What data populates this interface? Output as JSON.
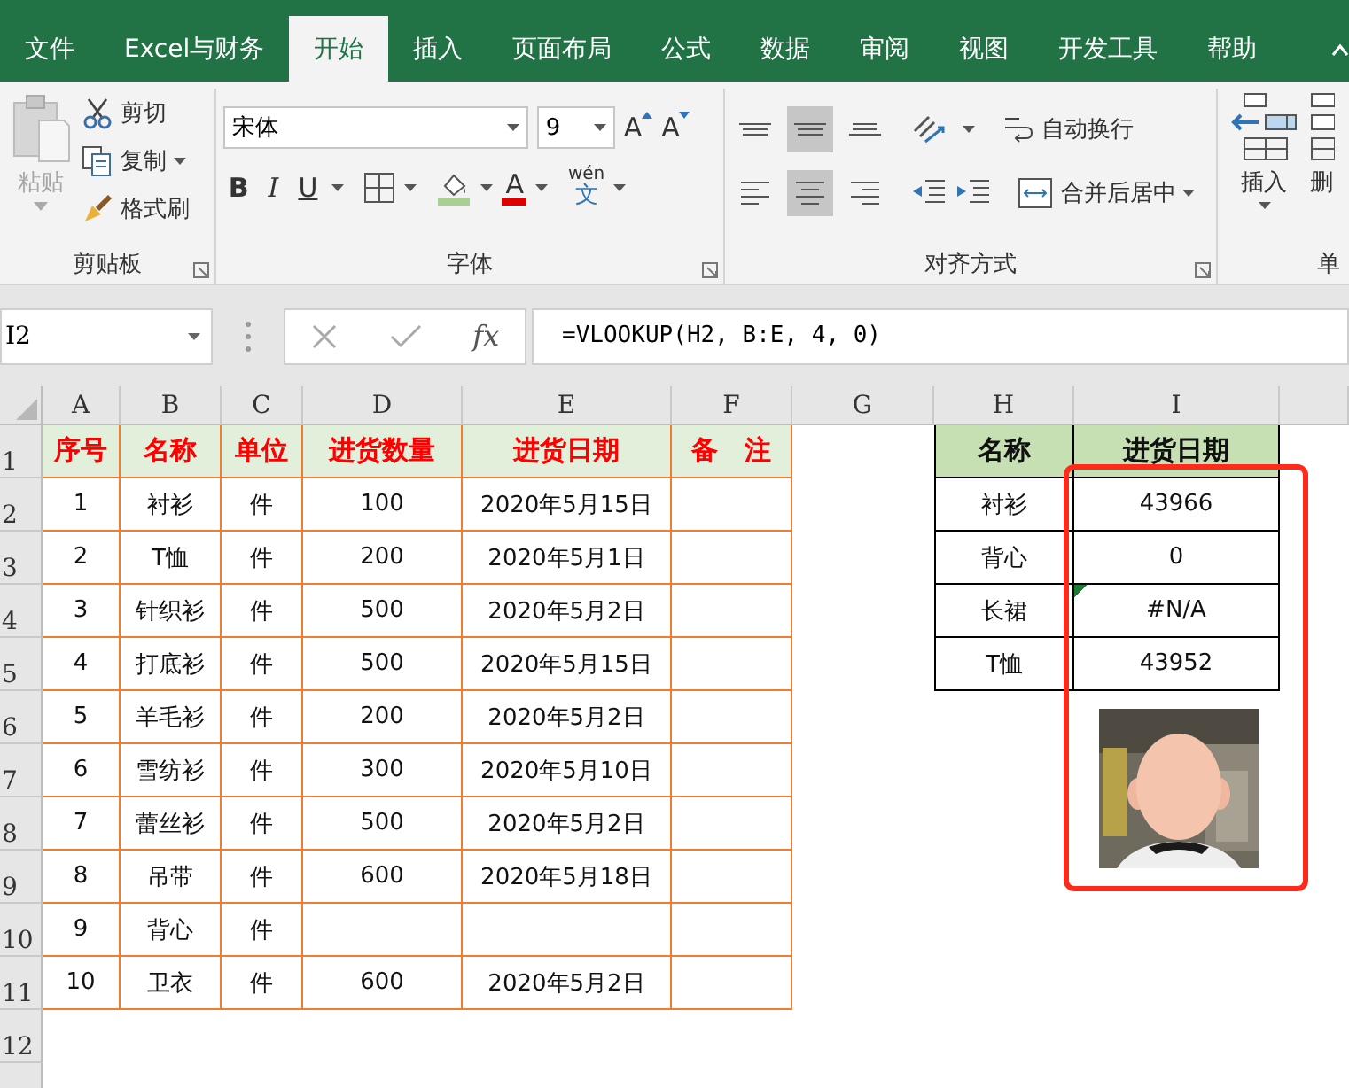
{
  "tabs": [
    {
      "label": "文件",
      "selected": false
    },
    {
      "label": "Excel与财务",
      "selected": false
    },
    {
      "label": "开始",
      "selected": true
    },
    {
      "label": "插入",
      "selected": false
    },
    {
      "label": "页面布局",
      "selected": false
    },
    {
      "label": "公式",
      "selected": false
    },
    {
      "label": "数据",
      "selected": false
    },
    {
      "label": "审阅",
      "selected": false
    },
    {
      "label": "视图",
      "selected": false
    },
    {
      "label": "开发工具",
      "selected": false
    },
    {
      "label": "帮助",
      "selected": false
    }
  ],
  "ribbon": {
    "clipboard": {
      "paste": "粘贴",
      "paste_disabled": true,
      "cut": "剪切",
      "copy": "复制",
      "format_painter": "格式刷",
      "label": "剪贴板"
    },
    "font": {
      "name": "宋体",
      "size": "9",
      "grow": "A",
      "shrink": "A",
      "bold": "B",
      "italic": "I",
      "underline": "U",
      "font_color": "A",
      "phonetic_top": "wén",
      "phonetic_bottom": "文",
      "label": "字体"
    },
    "alignment": {
      "vertical": [
        {
          "kind": "top",
          "selected": false
        },
        {
          "kind": "middle",
          "selected": true
        },
        {
          "kind": "bottom",
          "selected": false
        }
      ],
      "horizontal": [
        {
          "kind": "left",
          "selected": false
        },
        {
          "kind": "center",
          "selected": true
        },
        {
          "kind": "right",
          "selected": false
        }
      ],
      "wrap_text": "自动换行",
      "merge_center": "合并后居中",
      "label": "对齐方式"
    },
    "cells": {
      "insert": "插入",
      "delete": "删",
      "label": "单"
    }
  },
  "formula_bar": {
    "name_box": "I2",
    "fx": "fx",
    "formula": "=VLOOKUP(H2, B:E, 4, 0)"
  },
  "sheet": {
    "columns": [
      "A",
      "B",
      "C",
      "D",
      "E",
      "F",
      "G",
      "H",
      "I"
    ],
    "row_numbers": [
      "1",
      "2",
      "3",
      "4",
      "5",
      "6",
      "7",
      "8",
      "9",
      "10",
      "11",
      "12"
    ],
    "table": {
      "columns": [
        "序号",
        "名称",
        "单位",
        "进货数量",
        "进货日期",
        "备　注"
      ],
      "rows": [
        [
          "1",
          "衬衫",
          "件",
          "100",
          "2020年5月15日",
          ""
        ],
        [
          "2",
          "T恤",
          "件",
          "200",
          "2020年5月1日",
          ""
        ],
        [
          "3",
          "针织衫",
          "件",
          "500",
          "2020年5月2日",
          ""
        ],
        [
          "4",
          "打底衫",
          "件",
          "500",
          "2020年5月15日",
          ""
        ],
        [
          "5",
          "羊毛衫",
          "件",
          "200",
          "2020年5月2日",
          ""
        ],
        [
          "6",
          "雪纺衫",
          "件",
          "300",
          "2020年5月10日",
          ""
        ],
        [
          "7",
          "蕾丝衫",
          "件",
          "500",
          "2020年5月2日",
          ""
        ],
        [
          "8",
          "吊带",
          "件",
          "600",
          "2020年5月18日",
          ""
        ],
        [
          "9",
          "背心",
          "件",
          "",
          "",
          ""
        ],
        [
          "10",
          "卫衣",
          "件",
          "600",
          "2020年5月2日",
          ""
        ]
      ]
    },
    "lookup": {
      "columns": [
        "名称",
        "进货日期"
      ],
      "rows": [
        {
          "name": "衬衫",
          "value": "43966",
          "flagged": false
        },
        {
          "name": "背心",
          "value": "0",
          "flagged": false
        },
        {
          "name": "长裙",
          "value": "#N/A",
          "flagged": true
        },
        {
          "name": "T恤",
          "value": "43952",
          "flagged": false
        }
      ]
    },
    "picture": {
      "kind": "picture"
    },
    "annotation": {
      "kind": "rectangle"
    }
  }
}
